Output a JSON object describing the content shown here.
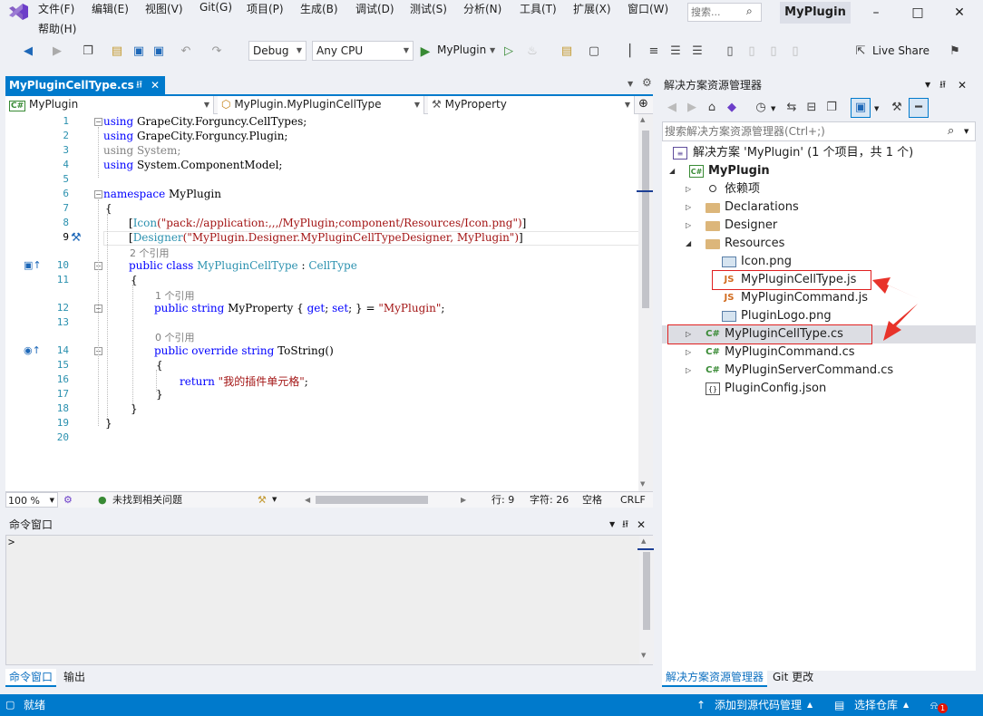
{
  "menu": {
    "items": [
      "文件(F)",
      "编辑(E)",
      "视图(V)",
      "Git(G)",
      "项目(P)",
      "生成(B)",
      "调试(D)",
      "测试(S)",
      "分析(N)",
      "工具(T)",
      "扩展(X)",
      "窗口(W)"
    ],
    "help": "帮助(H)",
    "search_placeholder": "搜索...",
    "app_name": "MyPlugin"
  },
  "toolbar": {
    "config": "Debug",
    "platform": "Any CPU",
    "run_target": "MyPlugin",
    "live_share": "Live Share"
  },
  "editor": {
    "tab_title": "MyPluginCellType.cs",
    "nav_project": "MyPlugin",
    "nav_class": "MyPlugin.MyPluginCellType",
    "nav_member": "MyProperty",
    "line_numbers": [
      "1",
      "2",
      "3",
      "4",
      "5",
      "6",
      "7",
      "8",
      "9",
      "10",
      "11",
      "12",
      "13",
      "14",
      "15",
      "16",
      "17",
      "18",
      "19",
      "20"
    ],
    "lens": {
      "class_refs": "2 个引用",
      "prop_refs": "1 个引用",
      "tostring_refs": "0 个引用"
    },
    "code": {
      "l1_kw": "using",
      "l1_rest": " GrapeCity.Forguncy.CellTypes;",
      "l2_kw": "using",
      "l2_rest": " GrapeCity.Forguncy.Plugin;",
      "l3_kw": "using",
      "l3_rest": " System;",
      "l4_kw": "using",
      "l4_rest": " System.ComponentModel;",
      "l6_kw": "namespace",
      "l6_rest": " MyPlugin",
      "l7": "{",
      "l8_open": "[",
      "l8_attr": "Icon",
      "l8_str": "(\"pack://application:,,,/MyPlugin;component/Resources/Icon.png\")",
      "l8_close": "]",
      "l9_open": "[",
      "l9_attr": "Designer",
      "l9_str": "(\"MyPlugin.Designer.MyPluginCellTypeDesigner, MyPlugin\")",
      "l9_close": "]",
      "l10_kw": "public class",
      "l10_name": " MyPluginCellType",
      "l10_colon": " : ",
      "l10_base": "CellType",
      "l11": "{",
      "l12_kw1": "public string",
      "l12_name": " MyProperty { ",
      "l12_get": "get",
      "l12_semi1": "; ",
      "l12_set": "set",
      "l12_semi2": "; } = ",
      "l12_str": "\"MyPlugin\"",
      "l12_end": ";",
      "l14_kw": "public override string",
      "l14_name": " ToString()",
      "l15": "{",
      "l16_kw": "return",
      "l16_str": " \"我的插件单元格\"",
      "l16_end": ";",
      "l17": "}",
      "l18": "}",
      "l19": "}"
    },
    "status": {
      "zoom": "100 %",
      "issues": "未找到相关问题",
      "line": "行: 9",
      "col": "字符: 26",
      "spaces": "空格",
      "eol": "CRLF"
    }
  },
  "command_window": {
    "title": "命令窗口",
    "prompt": ">",
    "tabs": [
      "命令窗口",
      "输出"
    ]
  },
  "solution_explorer": {
    "title": "解决方案资源管理器",
    "search_placeholder": "搜索解决方案资源管理器(Ctrl+;)",
    "solution": "解决方案 'MyPlugin' (1 个项目，共 1 个)",
    "project": "MyPlugin",
    "nodes": {
      "deps": "依赖项",
      "declarations": "Declarations",
      "designer": "Designer",
      "resources": "Resources",
      "icon_png": "Icon.png",
      "celltype_js": "MyPluginCellType.js",
      "command_js": "MyPluginCommand.js",
      "logo_png": "PluginLogo.png",
      "celltype_cs": "MyPluginCellType.cs",
      "command_cs": "MyPluginCommand.cs",
      "server_cs": "MyPluginServerCommand.cs",
      "config_json": "PluginConfig.json"
    },
    "tabs": [
      "解决方案资源管理器",
      "Git 更改"
    ],
    "highlight_color": "#e02020"
  },
  "statusbar": {
    "ready": "就绪",
    "add_source": "添加到源代码管理",
    "select_repo": "选择仓库",
    "notifications": "1"
  },
  "colors": {
    "accent": "#007acc",
    "keyword": "#0000ff",
    "type": "#2b91af",
    "string": "#a31515"
  }
}
